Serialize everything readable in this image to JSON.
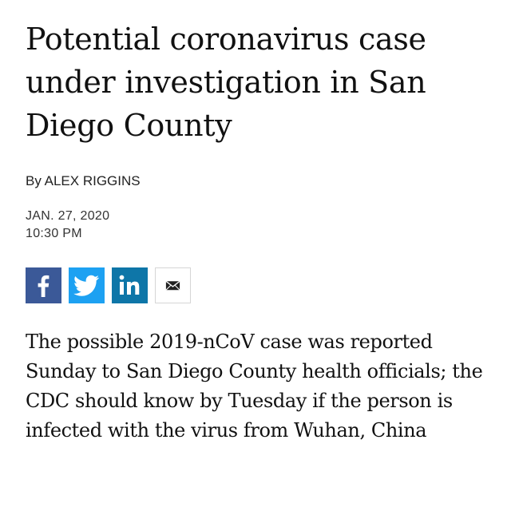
{
  "article": {
    "headline": "Potential coronavirus case under investigation in San Diego County",
    "byline": "By ALEX RIGGINS",
    "date": "JAN. 27, 2020",
    "time": "10:30 PM",
    "summary": "The possible 2019-nCoV case was reported Sunday to San Diego County health officials; the CDC should know by Tuesday if the person is infected with the virus from Wuhan, China"
  },
  "share": {
    "buttons": [
      {
        "network": "facebook",
        "icon": "facebook-icon",
        "color": "#3b5998"
      },
      {
        "network": "twitter",
        "icon": "twitter-icon",
        "color": "#1da1f2"
      },
      {
        "network": "linkedin",
        "icon": "linkedin-icon",
        "color": "#0e76a8"
      },
      {
        "network": "email",
        "icon": "email-icon",
        "color": "#ffffff"
      }
    ]
  }
}
